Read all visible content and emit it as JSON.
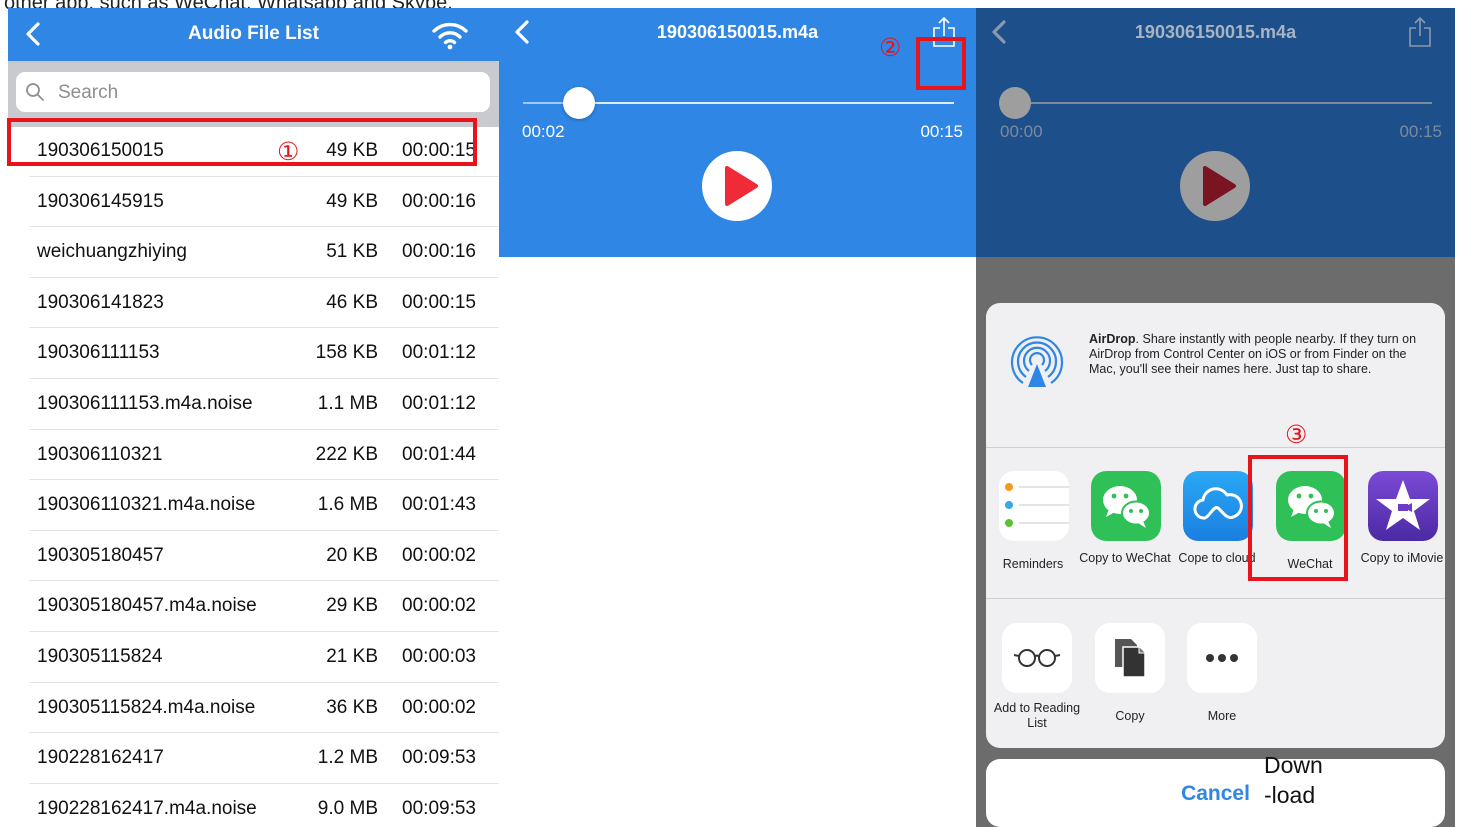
{
  "caption": "other app, such as WeChat, Whatsapp and Skype.",
  "panel1": {
    "title": "Audio File List",
    "search_placeholder": "Search",
    "files": [
      {
        "name": "190306150015",
        "size": "49 KB",
        "duration": "00:00:15"
      },
      {
        "name": "190306145915",
        "size": "49 KB",
        "duration": "00:00:16"
      },
      {
        "name": "weichuangzhiying",
        "size": "51 KB",
        "duration": "00:00:16"
      },
      {
        "name": "190306141823",
        "size": "46 KB",
        "duration": "00:00:15"
      },
      {
        "name": "190306111153",
        "size": "158 KB",
        "duration": "00:01:12"
      },
      {
        "name": "190306111153.m4a.noise",
        "size": "1.1 MB",
        "duration": "00:01:12"
      },
      {
        "name": "190306110321",
        "size": "222 KB",
        "duration": "00:01:44"
      },
      {
        "name": "190306110321.m4a.noise",
        "size": "1.6 MB",
        "duration": "00:01:43"
      },
      {
        "name": "190305180457",
        "size": "20 KB",
        "duration": "00:00:02"
      },
      {
        "name": "190305180457.m4a.noise",
        "size": "29 KB",
        "duration": "00:00:02"
      },
      {
        "name": "190305115824",
        "size": "21 KB",
        "duration": "00:00:03"
      },
      {
        "name": "190305115824.m4a.noise",
        "size": "36 KB",
        "duration": "00:00:02"
      },
      {
        "name": "190228162417",
        "size": "1.2 MB",
        "duration": "00:09:53"
      },
      {
        "name": "190228162417.m4a.noise",
        "size": "9.0 MB",
        "duration": "00:09:53"
      }
    ]
  },
  "player": {
    "title": "190306150015.m4a",
    "current_time": "00:02",
    "total_time": "00:15",
    "progress": 0.13
  },
  "share": {
    "player_title": "190306150015.m4a",
    "current_time": "00:00",
    "total_time": "00:15",
    "airdrop_bold": "AirDrop",
    "airdrop_text": ". Share instantly with people nearby. If they turn on AirDrop from Control Center on iOS or from Finder on the Mac, you'll see their names here. Just tap to share.",
    "apps": [
      {
        "label": "Reminders",
        "icon": "reminders-icon"
      },
      {
        "label": "Copy to WeChat",
        "icon": "wechat-icon"
      },
      {
        "label": "Cope to cloud",
        "icon": "cloud-icon"
      },
      {
        "label": "WeChat",
        "icon": "wechat-icon"
      },
      {
        "label": "Copy to iMovie",
        "icon": "imovie-icon"
      }
    ],
    "actions": [
      {
        "label": "Add to Reading List",
        "icon": "glasses-icon"
      },
      {
        "label": "Copy",
        "icon": "copy-icon"
      },
      {
        "label": "More",
        "icon": "more-icon"
      }
    ],
    "cancel": "Cancel"
  },
  "annotations": {
    "step1": "①",
    "step2": "②",
    "step3": "③",
    "download_line1": "Down",
    "download_line2": "-load"
  },
  "colors": {
    "header_blue": "#2f86e4",
    "highlight_red": "#e8141c",
    "wechat_green": "#2fc158",
    "play_red": "#ef2b3a"
  }
}
